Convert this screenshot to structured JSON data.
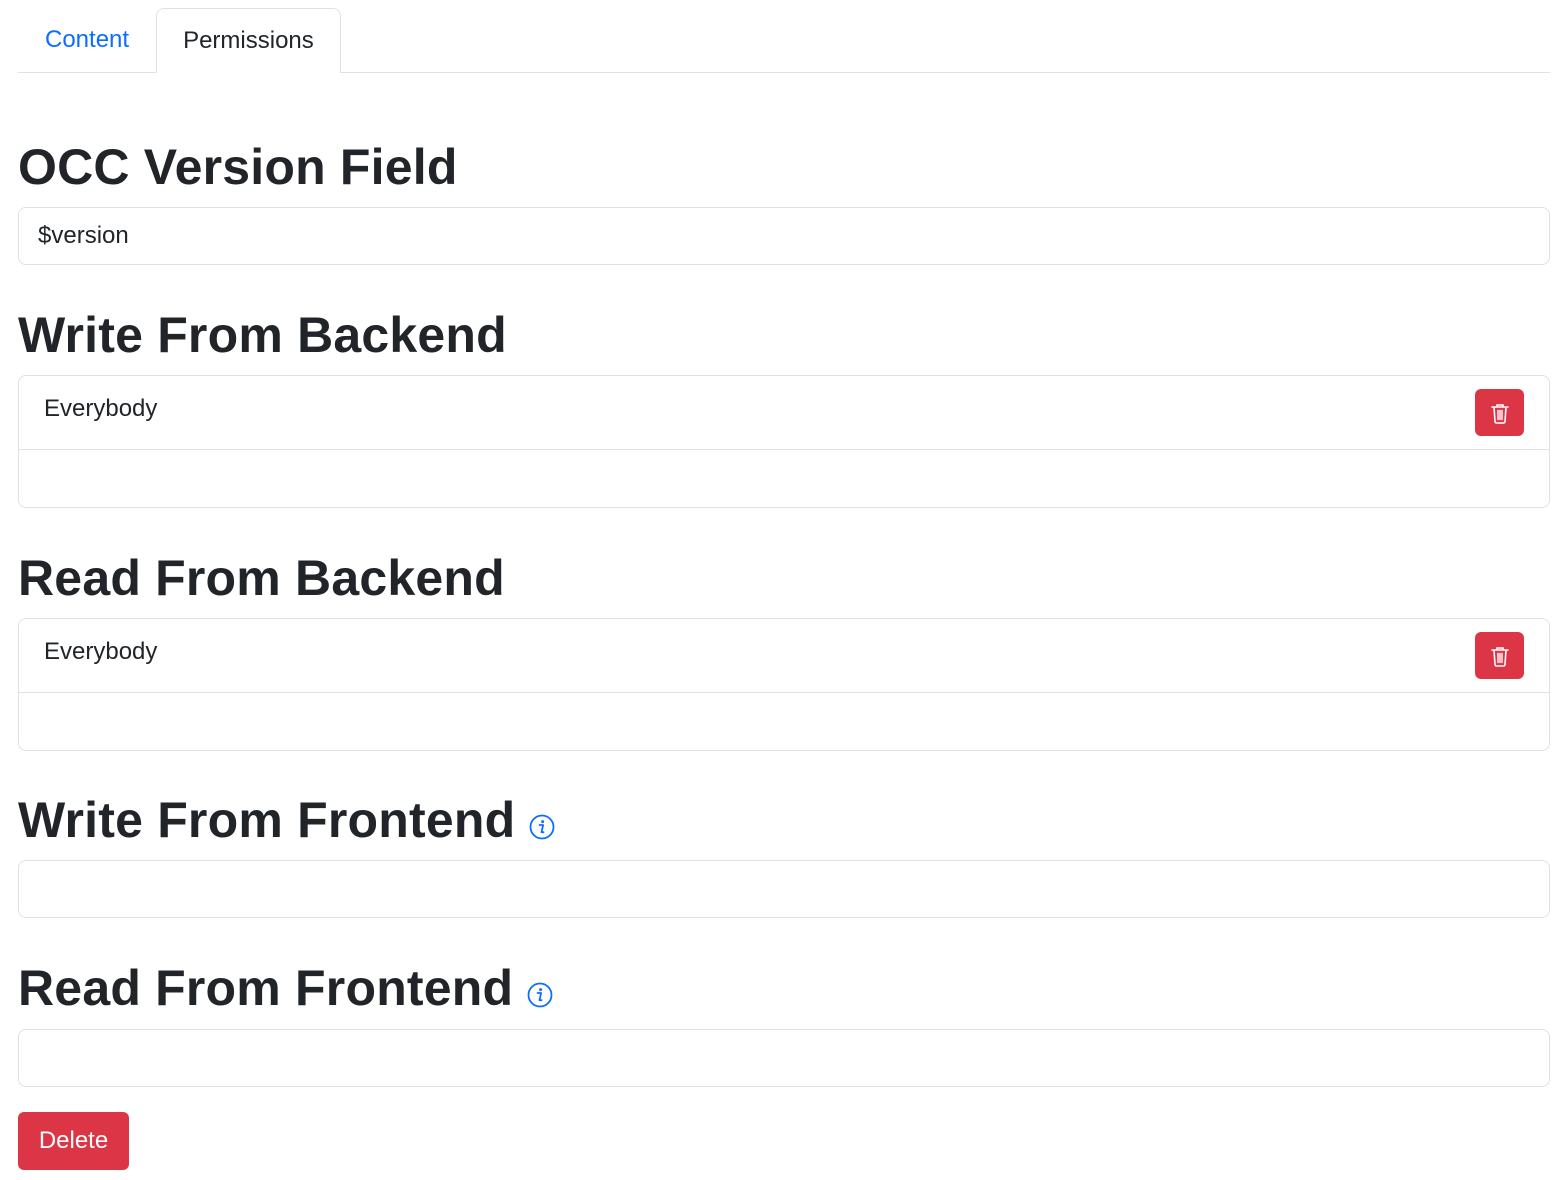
{
  "tabs": [
    {
      "label": "Content",
      "active": false
    },
    {
      "label": "Permissions",
      "active": true
    }
  ],
  "sections": {
    "occ": {
      "title": "OCC Version Field",
      "value": "$version"
    },
    "write_backend": {
      "title": "Write From Backend",
      "items": [
        "Everybody"
      ],
      "input_value": ""
    },
    "read_backend": {
      "title": "Read From Backend",
      "items": [
        "Everybody"
      ],
      "input_value": ""
    },
    "write_frontend": {
      "title": "Write From Frontend",
      "input_value": ""
    },
    "read_frontend": {
      "title": "Read From Frontend",
      "input_value": ""
    }
  },
  "actions": {
    "delete_label": "Delete"
  },
  "colors": {
    "link": "#0d6efd",
    "danger": "#dc3545",
    "border": "#dee2e6",
    "text": "#212529"
  },
  "icons": {
    "remove": "trash-icon",
    "info": "info-circle-icon"
  }
}
